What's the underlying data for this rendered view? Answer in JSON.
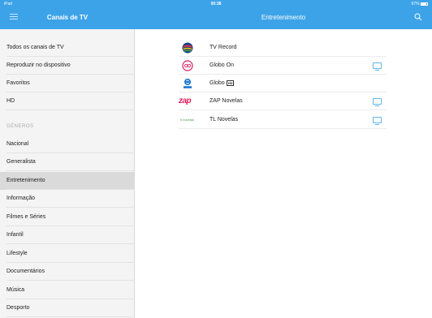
{
  "status_bar": {
    "carrier": "iPad",
    "time": "00:38",
    "battery": "67%"
  },
  "header": {
    "sidebar_title": "Canais de TV",
    "main_title": "Entretenimento"
  },
  "sidebar": {
    "items_top": [
      {
        "label": "Todos os canais de TV"
      },
      {
        "label": "Reproduzir no dispositivo"
      },
      {
        "label": "Favoritos"
      },
      {
        "label": "HD"
      }
    ],
    "section_title": "GÉNEROS",
    "genres": [
      {
        "label": "Nacional"
      },
      {
        "label": "Generalista"
      },
      {
        "label": "Entretenimento",
        "selected": true
      },
      {
        "label": "Informação"
      },
      {
        "label": "Filmes e Séries"
      },
      {
        "label": "Infantil"
      },
      {
        "label": "Lifestyle"
      },
      {
        "label": "Documentários"
      },
      {
        "label": "Música"
      },
      {
        "label": "Desporto"
      }
    ]
  },
  "channels": [
    {
      "name": "TV Record",
      "logo": "tv-record-logo",
      "play_on_device": false
    },
    {
      "name": "Globo On",
      "logo": "globo-on-logo",
      "play_on_device": true
    },
    {
      "name": "Globo",
      "logo": "globo-logo",
      "badge": "HD",
      "play_on_device": false
    },
    {
      "name": "ZAP Novelas",
      "logo": "zap-novelas-logo",
      "logo_text": "zap",
      "play_on_device": true
    },
    {
      "name": "TL Novelas",
      "logo": "tl-novelas-logo",
      "logo_text": "tl novelas",
      "play_on_device": true
    }
  ],
  "colors": {
    "header": "#3da3e8",
    "accent": "#5fb5ec",
    "selected_row": "#dadada",
    "sidebar_bg": "#f4f4f4"
  }
}
